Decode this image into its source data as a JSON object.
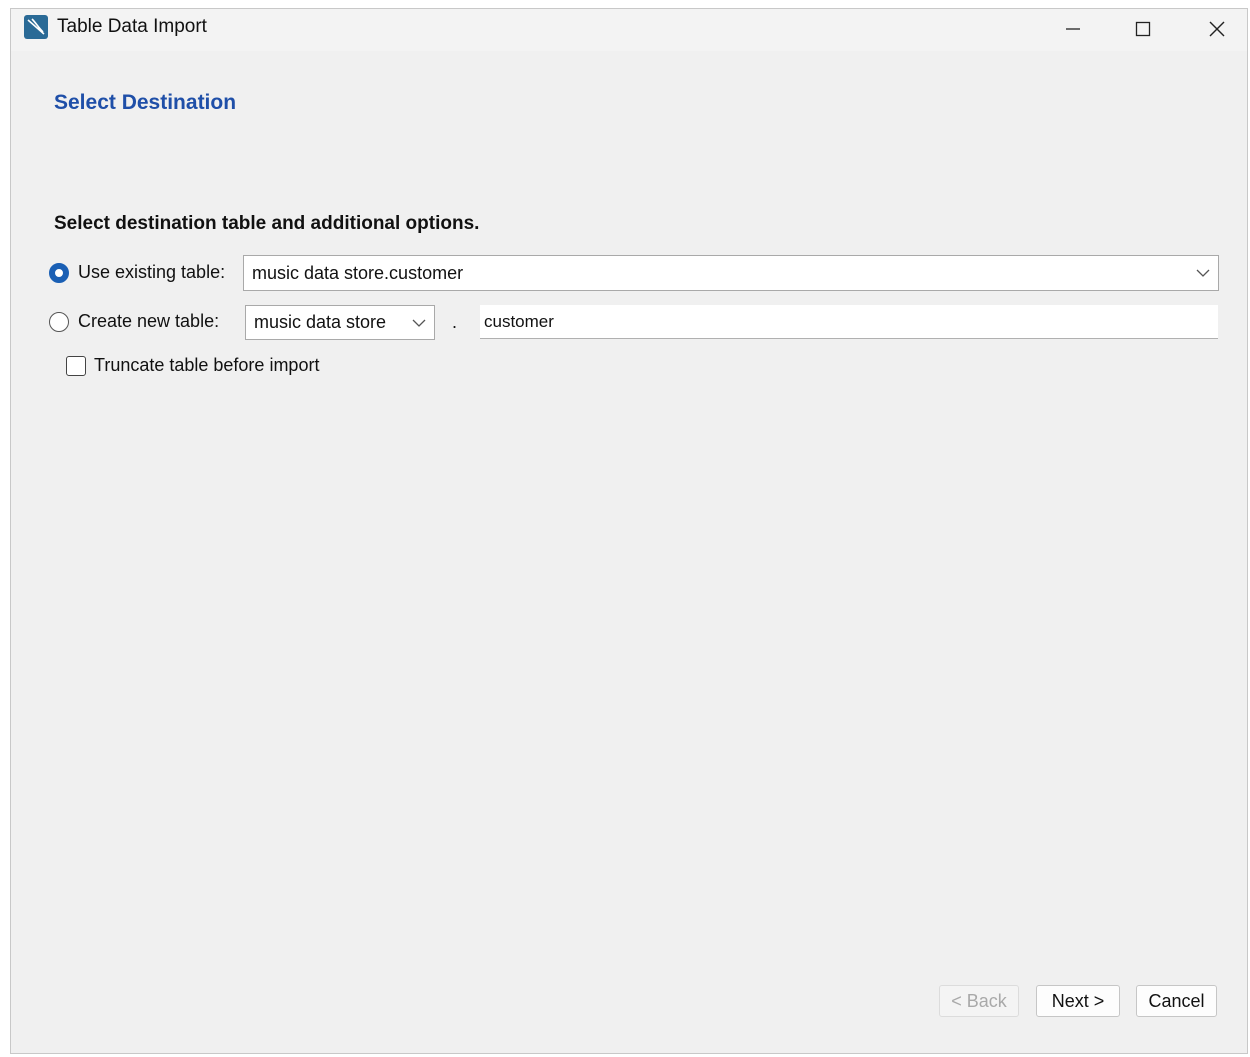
{
  "window": {
    "title": "Table Data Import"
  },
  "page": {
    "heading": "Select Destination",
    "instruction": "Select destination table and additional options."
  },
  "options": {
    "use_existing_label": "Use existing table:",
    "use_existing_value": "music data store.customer",
    "create_new_label": "Create new table:",
    "schema_value": "music data store",
    "separator": ".",
    "table_name_value": "customer",
    "truncate_label": "Truncate table before import"
  },
  "buttons": {
    "back": "< Back",
    "next": "Next >",
    "cancel": "Cancel"
  },
  "colors": {
    "heading": "#1f4fa8",
    "accent": "#1a5fb4"
  }
}
